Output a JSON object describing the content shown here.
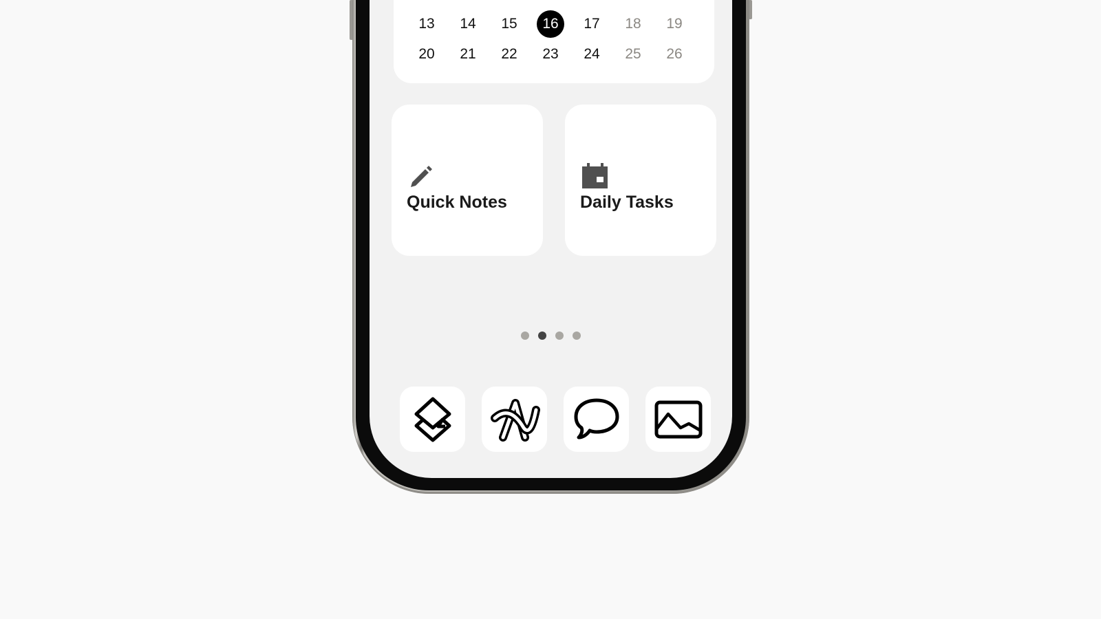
{
  "calendar": {
    "rows": [
      [
        {
          "d": "13"
        },
        {
          "d": "14"
        },
        {
          "d": "15"
        },
        {
          "d": "16",
          "today": true
        },
        {
          "d": "17"
        },
        {
          "d": "18",
          "weekend": true
        },
        {
          "d": "19",
          "weekend": true
        }
      ],
      [
        {
          "d": "20"
        },
        {
          "d": "21"
        },
        {
          "d": "22"
        },
        {
          "d": "23"
        },
        {
          "d": "24"
        },
        {
          "d": "25",
          "weekend": true
        },
        {
          "d": "26",
          "weekend": true
        }
      ]
    ],
    "today": "16"
  },
  "widgets": [
    {
      "label": "Quick Notes",
      "icon": "pencil-icon"
    },
    {
      "label": "Daily Tasks",
      "icon": "calendar-icon"
    }
  ],
  "page_dots": {
    "count": 4,
    "active_index": 1
  },
  "dock": [
    {
      "name": "layers-app",
      "icon": "layers-icon"
    },
    {
      "name": "a-logo-app",
      "icon": "a-logo-icon"
    },
    {
      "name": "messages-app",
      "icon": "speech-bubble-icon"
    },
    {
      "name": "photos-app",
      "icon": "image-icon"
    }
  ],
  "colors": {
    "accent": "#000000",
    "weekend": "#8b8883",
    "icon_gray": "#505050",
    "dot_inactive": "#a9a7a2",
    "dot_active": "#444444"
  }
}
